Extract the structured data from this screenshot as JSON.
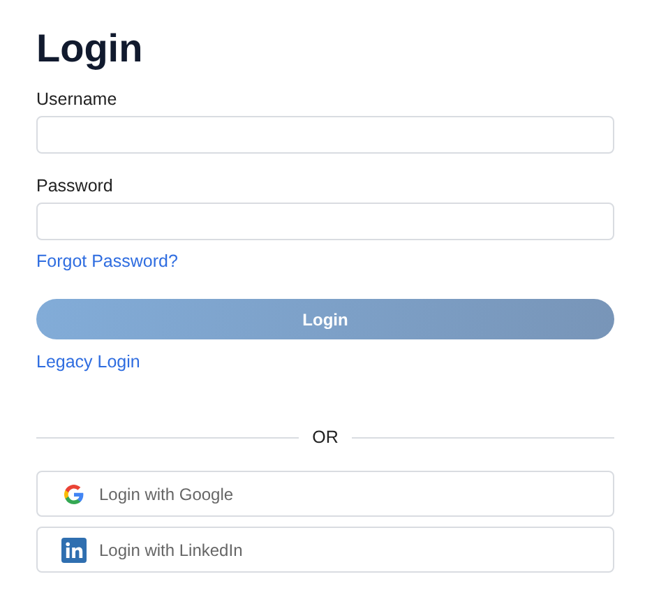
{
  "title": "Login",
  "fields": [
    {
      "label": "Username"
    },
    {
      "label": "Password"
    }
  ],
  "forgot_link": "Forgot Password?",
  "login_button": {
    "label": "Login",
    "disabled": true
  },
  "legacy_link": "Legacy Login",
  "divider": "OR",
  "social_buttons": [
    {
      "kind": "google",
      "label": "Login with Google"
    },
    {
      "kind": "linkedin",
      "label": "Login with LinkedIn"
    }
  ]
}
